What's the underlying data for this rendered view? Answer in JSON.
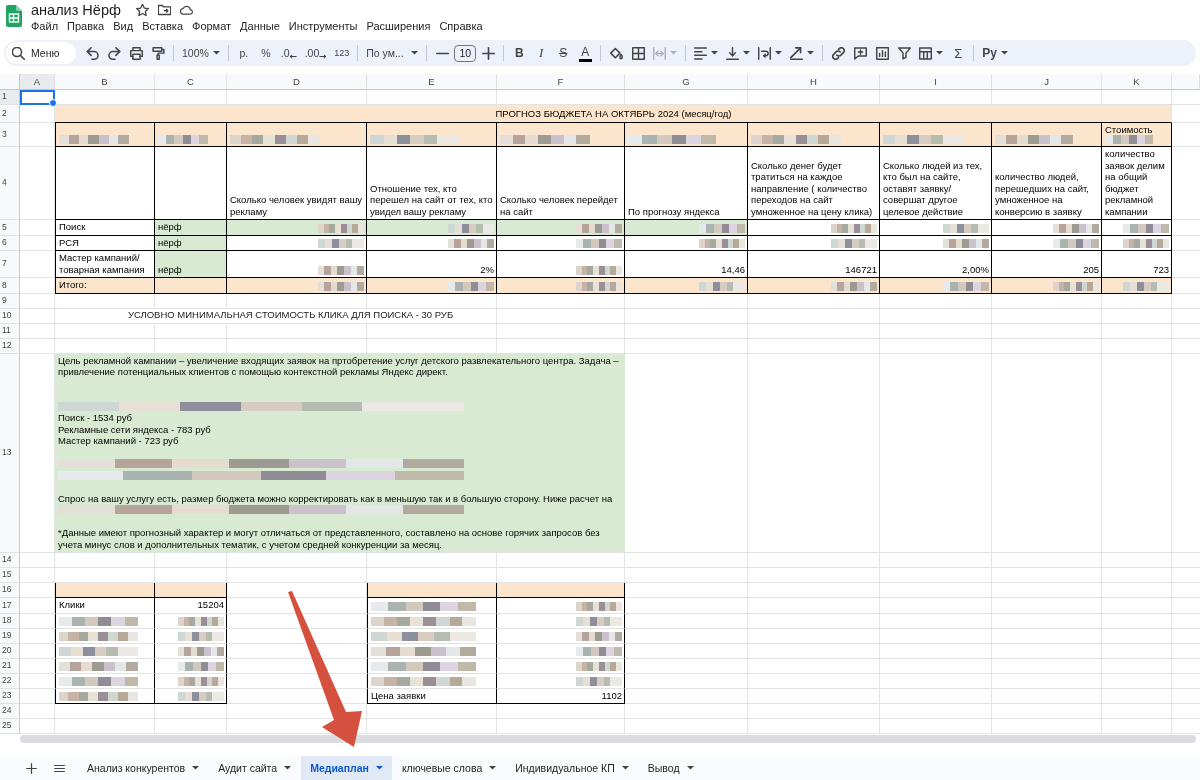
{
  "title": "анализ Нёрф",
  "menu": [
    "Файл",
    "Правка",
    "Вид",
    "Вставка",
    "Формат",
    "Данные",
    "Инструменты",
    "Расширения",
    "Справка"
  ],
  "toolbar": {
    "search": "Меню",
    "zoom": "100%",
    "currency": "р.",
    "percent": "%",
    "decrease_decimals": ".0",
    "increase_decimals": ".00",
    "number_format": "123",
    "font": "По ум...",
    "font_size": "10",
    "bold": "B",
    "italic": "I",
    "strikethrough": "S",
    "text_color": "A",
    "merge": {
      "disabled": true
    },
    "functions": "Σ",
    "input_tools": "Ру"
  },
  "sheet": {
    "columns": [
      {
        "label": "A",
        "selected": true
      },
      {
        "label": "B",
        "selected": false
      },
      {
        "label": "C",
        "selected": false
      },
      {
        "label": "D",
        "selected": false
      },
      {
        "label": "E",
        "selected": false
      },
      {
        "label": "F",
        "selected": false
      },
      {
        "label": "G",
        "selected": false
      },
      {
        "label": "H",
        "selected": false
      },
      {
        "label": "I",
        "selected": false
      },
      {
        "label": "J",
        "selected": false
      },
      {
        "label": "K",
        "selected": false
      }
    ],
    "rows": [
      {
        "label": "1",
        "selected": true
      },
      {
        "label": "2",
        "selected": false
      },
      {
        "label": "3",
        "selected": false
      },
      {
        "label": "4",
        "selected": false
      },
      {
        "label": "5",
        "selected": false
      },
      {
        "label": "6",
        "selected": false
      },
      {
        "label": "7",
        "selected": false
      },
      {
        "label": "8",
        "selected": false
      },
      {
        "label": "9",
        "selected": false
      },
      {
        "label": "10",
        "selected": false
      },
      {
        "label": "11",
        "selected": false
      },
      {
        "label": "12",
        "selected": false
      },
      {
        "label": "13",
        "selected": false
      },
      {
        "label": "14",
        "selected": false
      },
      {
        "label": "15",
        "selected": false
      },
      {
        "label": "16",
        "selected": false
      },
      {
        "label": "17",
        "selected": false
      },
      {
        "label": "18",
        "selected": false
      },
      {
        "label": "19",
        "selected": false
      },
      {
        "label": "20",
        "selected": false
      },
      {
        "label": "21",
        "selected": false
      },
      {
        "label": "22",
        "selected": false
      },
      {
        "label": "23",
        "selected": false
      },
      {
        "label": "24",
        "selected": false
      },
      {
        "label": "25",
        "selected": false
      }
    ]
  },
  "budget_table": {
    "title": "ПРОГНОЗ БЮДЖЕТА НА ОКТЯБРЬ 2024 (месяц/год)",
    "columns": [
      {
        "header": {
          "redacted": true
        }
      },
      {
        "header": {
          "redacted": true
        }
      },
      {
        "header": {
          "redacted": true
        },
        "description": "Сколько человек увидят вашу рекламу"
      },
      {
        "header": {
          "redacted": true
        },
        "description": "Отношение тех, кто перешел на сайт от тех, кто увидел вашу рекламу"
      },
      {
        "header": {
          "redacted": true
        },
        "description": "Сколько человек перейдет на сайт"
      },
      {
        "header": {
          "redacted": true
        },
        "description": "По прогнозу яндекса"
      },
      {
        "header": {
          "redacted": true
        },
        "description": "Сколько денег будет тратиться на каждое направление ( количество переходов на сайт умноженное на цену клика)"
      },
      {
        "header": {
          "redacted": true
        },
        "description": "Сколько людей из тех, кто был на сайте, оставят заявку/совершат другое целевое действие"
      },
      {
        "header": {
          "redacted": true
        },
        "description": "количество людей, перешедших на сайт, умноженное на конверсию в заявку"
      },
      {
        "header": {
          "text": "Стоимость",
          "redacted": true
        },
        "description": "количество заявок делим на общий бюджет рекламной кампании"
      }
    ],
    "rows": [
      {
        "cells": [
          {
            "text": "Поиск",
            "redacted": false,
            "highlighted": false
          },
          {
            "text": "нёрф",
            "redacted": false,
            "highlighted": true
          },
          {
            "redacted": true,
            "highlighted": true
          },
          {
            "redacted": true,
            "highlighted": true
          },
          {
            "redacted": true,
            "highlighted": true
          },
          {
            "redacted": true,
            "highlighted": true
          },
          {
            "redacted": true,
            "highlighted": false
          },
          {
            "redacted": true,
            "highlighted": false
          },
          {
            "redacted": true,
            "highlighted": false
          },
          {
            "redacted": true,
            "highlighted": false
          }
        ]
      },
      {
        "cells": [
          {
            "text": "РСЯ",
            "redacted": false,
            "highlighted": false
          },
          {
            "text": "нёрф",
            "redacted": false,
            "highlighted": true
          },
          {
            "redacted": true,
            "highlighted": false
          },
          {
            "redacted": true,
            "highlighted": false
          },
          {
            "redacted": true,
            "highlighted": false
          },
          {
            "redacted": true,
            "highlighted": false
          },
          {
            "redacted": true,
            "highlighted": false
          },
          {
            "redacted": true,
            "highlighted": false
          },
          {
            "redacted": true,
            "highlighted": false
          },
          {
            "redacted": true,
            "highlighted": false
          }
        ]
      },
      {
        "cells": [
          {
            "text": "Мастер кампаний/товарная кампания",
            "redacted": false,
            "highlighted": false
          },
          {
            "text": "нёрф",
            "redacted": false,
            "highlighted": true
          },
          {
            "redacted": true,
            "highlighted": false
          },
          {
            "text": "2%",
            "redacted": false,
            "highlighted": false
          },
          {
            "redacted": true,
            "highlighted": false
          },
          {
            "text": "14,46",
            "redacted": false,
            "highlighted": false
          },
          {
            "text": "146721",
            "redacted": false,
            "highlighted": false
          },
          {
            "text": "2,00%",
            "redacted": false,
            "highlighted": false
          },
          {
            "text": "205",
            "redacted": false,
            "highlighted": false
          },
          {
            "text": "723",
            "redacted": false,
            "highlighted": false
          }
        ]
      }
    ],
    "total": {
      "cells": [
        {
          "text": "Итого:",
          "redacted": false
        },
        {
          "redacted": false
        },
        {
          "redacted": true
        },
        {
          "redacted": true
        },
        {
          "redacted": true
        },
        {
          "redacted": true
        },
        {
          "redacted": true
        },
        {
          "redacted": true
        },
        {
          "redacted": true
        },
        {
          "redacted": true
        }
      ]
    }
  },
  "click_note": "УСЛОВНО МИНИМАЛЬНАЯ СТОИМОСТЬ КЛИКА ДЛЯ ПОИСКА - 30 РУБ",
  "campaign_text": [
    {
      "kind": "paragraph",
      "text": "Цель рекламной кампании – увеличение входящих заявок на пртобретение услуг детского развлекательного центра. Задача – привлечение потенциальных клиентов с помощью контекстной рекламы Яндекс директ."
    },
    {
      "kind": "gap"
    },
    {
      "kind": "gap"
    },
    {
      "kind": "redacted"
    },
    {
      "kind": "line",
      "text": "Поиск - 1534 руб"
    },
    {
      "kind": "line",
      "text": "Рекламные сети яндекса - 783 руб"
    },
    {
      "kind": "line",
      "text": "Мастер кампаний - 723 руб"
    },
    {
      "kind": "gap"
    },
    {
      "kind": "redacted"
    },
    {
      "kind": "redacted"
    },
    {
      "kind": "gap"
    },
    {
      "kind": "line",
      "text": "Спрос на вашу услугу есть, размер бюджета можно корректировать как в меньшую так и в большую сторону. Ниже расчет на"
    },
    {
      "kind": "redacted"
    },
    {
      "kind": "gap"
    },
    {
      "kind": "paragraph",
      "text": "*Данные имеют прогнозный характер и могут отличаться от представленного, составлено на основе горячих запросов без учета минус слов и дополнительных тематик, с учетом средней конкуренции за месяц."
    }
  ],
  "summary_tables": [
    {
      "rows": [
        {
          "label": {
            "text": "Клики",
            "redacted": false
          },
          "value": {
            "text": "15204",
            "redacted": false
          }
        },
        {
          "label": {
            "redacted": true
          },
          "value": {
            "redacted": true
          }
        },
        {
          "label": {
            "redacted": true
          },
          "value": {
            "redacted": true
          }
        },
        {
          "label": {
            "redacted": true
          },
          "value": {
            "redacted": true
          }
        },
        {
          "label": {
            "redacted": true
          },
          "value": {
            "redacted": true
          }
        },
        {
          "label": {
            "redacted": true
          },
          "value": {
            "redacted": true
          }
        },
        {
          "label": {
            "redacted": true
          },
          "value": {
            "redacted": true
          }
        }
      ]
    },
    {
      "rows": [
        {
          "label": {
            "redacted": true
          },
          "value": {
            "redacted": true
          }
        },
        {
          "label": {
            "redacted": true
          },
          "value": {
            "redacted": true
          }
        },
        {
          "label": {
            "redacted": true
          },
          "value": {
            "redacted": true
          }
        },
        {
          "label": {
            "redacted": true
          },
          "value": {
            "redacted": true
          }
        },
        {
          "label": {
            "redacted": true
          },
          "value": {
            "redacted": true
          }
        },
        {
          "label": {
            "redacted": true
          },
          "value": {
            "redacted": true
          }
        },
        {
          "label": {
            "text": "Цена заявки",
            "redacted": false
          },
          "value": {
            "text": "1102",
            "redacted": false
          }
        }
      ]
    }
  ],
  "sheet_tabs": [
    {
      "label": "Анализ конкурентов",
      "selected": false
    },
    {
      "label": "Аудит сайта",
      "selected": false
    },
    {
      "label": "Медиаплан",
      "selected": true
    },
    {
      "label": "ключевые слова",
      "selected": false
    },
    {
      "label": "Индивидуальное КП",
      "selected": false
    },
    {
      "label": "Вывод",
      "selected": false
    }
  ]
}
